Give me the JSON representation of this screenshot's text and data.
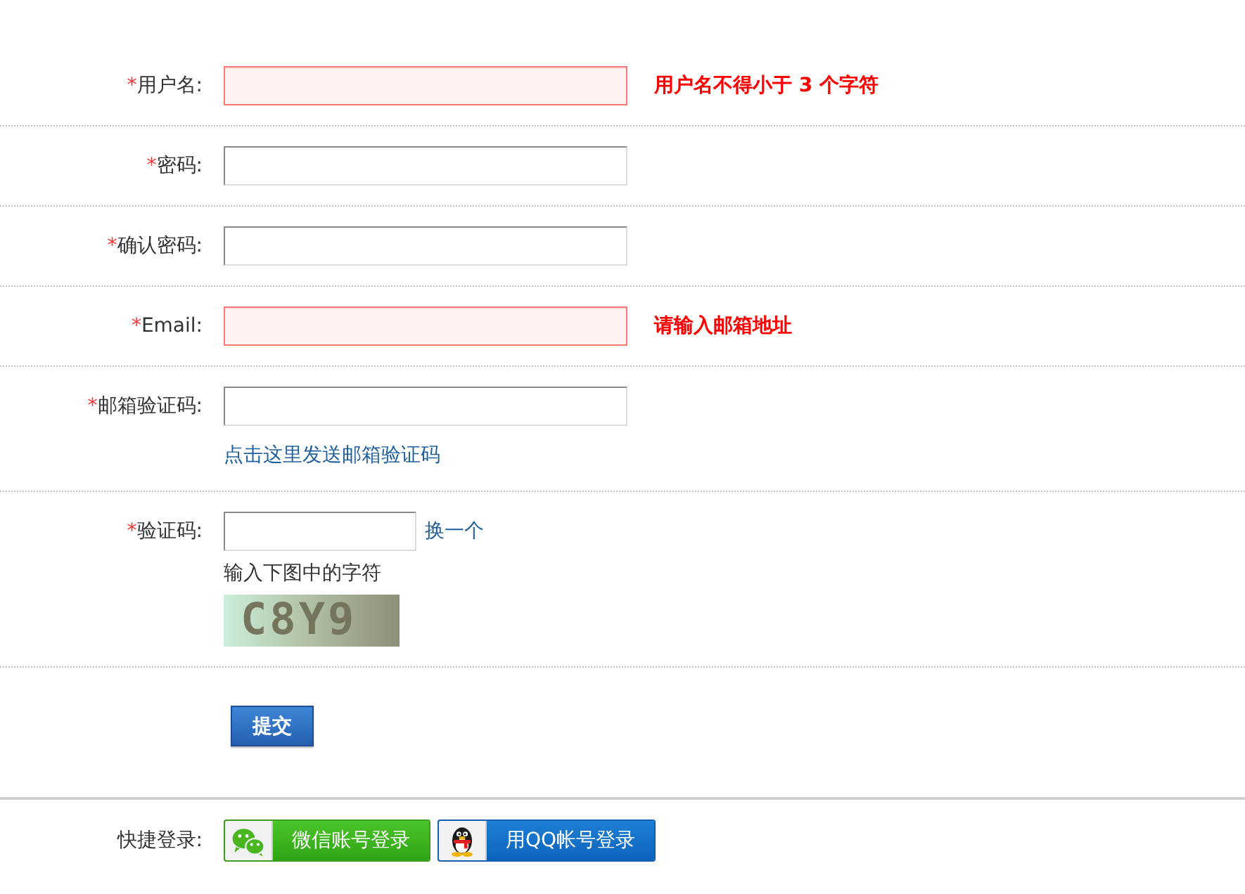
{
  "fields": [
    {
      "kind": "input",
      "required_mark": "*",
      "label": "用户名:",
      "invalid": true,
      "error": "用户名不得小于 3 个字符"
    },
    {
      "kind": "input",
      "required_mark": "*",
      "label": "密码:",
      "invalid": false
    },
    {
      "kind": "input",
      "required_mark": "*",
      "label": "确认密码:",
      "invalid": false
    },
    {
      "kind": "input",
      "required_mark": "*",
      "label": "Email:",
      "invalid": true,
      "error": "请输入邮箱地址"
    },
    {
      "kind": "input",
      "required_mark": "*",
      "label": "邮箱验证码:",
      "invalid": false,
      "link": "点击这里发送邮箱验证码"
    },
    {
      "kind": "captcha",
      "required_mark": "*",
      "label": "验证码:",
      "invalid": false,
      "refresh_link": "换一个",
      "hint": "输入下图中的字符",
      "captcha_text": "C8Y9"
    }
  ],
  "submit_button": "提交",
  "quick_login": {
    "label": "快捷登录:",
    "buttons": [
      {
        "kind": "wechat",
        "label": "微信账号登录"
      },
      {
        "kind": "qq",
        "label": "用QQ帐号登录"
      }
    ]
  }
}
